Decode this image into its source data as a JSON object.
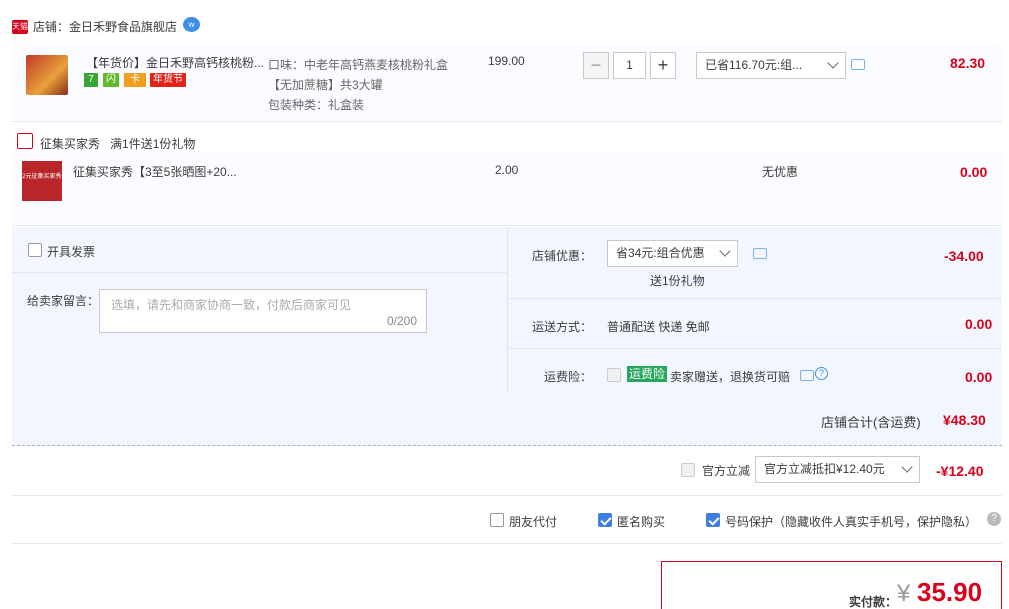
{
  "shop": {
    "badge": "天猫",
    "label": "店铺：",
    "name": "金日禾野食品旗舰店",
    "ww": "w"
  },
  "item1": {
    "title": "【年货价】金日禾野高钙核桃粉...",
    "tags": [
      "7",
      "闪",
      "卡",
      "年货节"
    ],
    "sku_lines": [
      "口味：中老年高钙燕麦核桃粉礼盒",
      "【无加蔗糖】共3大罐",
      "包装种类：礼盒装"
    ],
    "price": "199.00",
    "minus": "−",
    "qty": "1",
    "plus": "+",
    "discount": "已省116.70元:组...",
    "total": "82.30"
  },
  "gift": {
    "label": "征集买家秀",
    "rule": "满1件送1份礼物",
    "thumb_text": "2元征集买家秀",
    "title": "征集买家秀【3至5张晒图+20...",
    "price": "2.00",
    "discount": "无优惠",
    "total": "0.00"
  },
  "invoice": {
    "label": "开具发票"
  },
  "message": {
    "label": "给卖家留言：",
    "placeholder": "选填，请先和商家协商一致，付款后商家可见",
    "counter": "0/200"
  },
  "shop_discount": {
    "label": "店铺优惠：",
    "value": "省34元:组合优惠",
    "gift": "送1份礼物",
    "amount": "-34.00"
  },
  "shipping": {
    "label": "运送方式：",
    "value": "普通配送 快递 免邮",
    "amount": "0.00"
  },
  "insurance": {
    "label": "运费险：",
    "badge": "运费险",
    "text": "卖家赠送，退换货可赔",
    "amount": "0.00"
  },
  "shop_total": {
    "label": "店铺合计(含运费)",
    "amount": "¥48.30"
  },
  "official": {
    "label": "官方立减",
    "select": "官方立减抵扣¥12.40元",
    "amount": "-¥12.40"
  },
  "options": {
    "friend_pay": "朋友代付",
    "anonymous": "匿名购买",
    "privacy": "号码保护（隐藏收件人真实手机号，保护隐私）"
  },
  "payment": {
    "label": "实付款：",
    "currency": "¥",
    "amount": "35.90"
  },
  "colors": {
    "accent_red": "#d9001b",
    "checkbox_blue": "#3d7ee0",
    "panel_bg": "#f2f7ff"
  }
}
